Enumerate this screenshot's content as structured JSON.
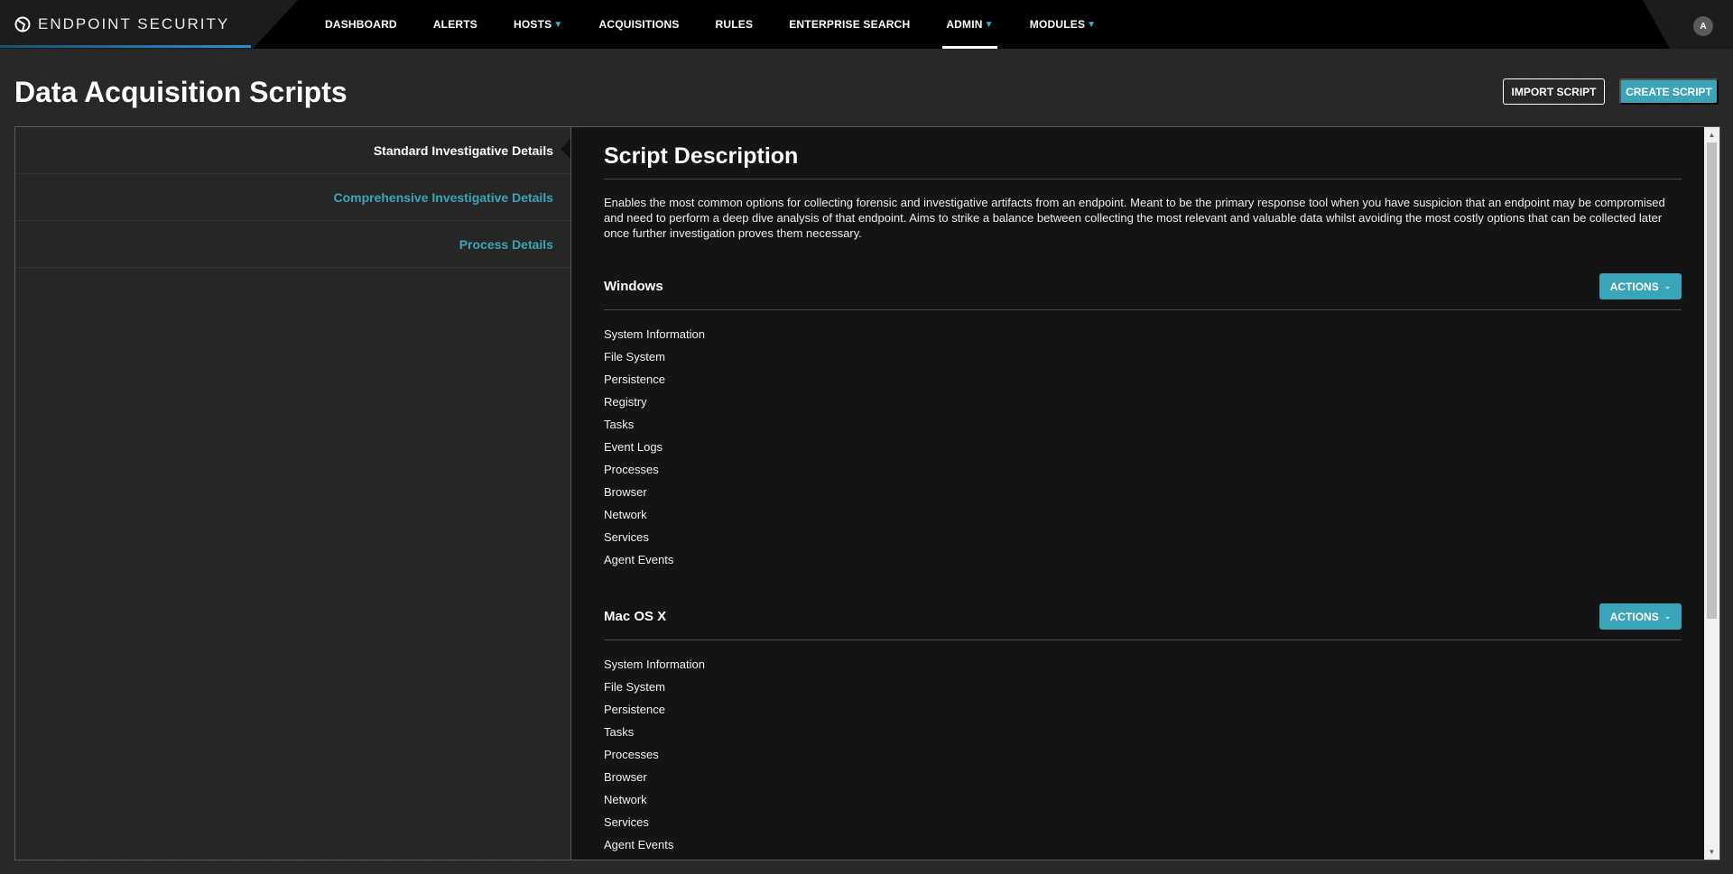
{
  "app": {
    "brand": "ENDPOINT SECURITY",
    "user_initial": "A"
  },
  "nav": {
    "items": [
      {
        "label": "DASHBOARD",
        "dropdown": false
      },
      {
        "label": "ALERTS",
        "dropdown": false
      },
      {
        "label": "HOSTS",
        "dropdown": true
      },
      {
        "label": "ACQUISITIONS",
        "dropdown": false
      },
      {
        "label": "RULES",
        "dropdown": false
      },
      {
        "label": "ENTERPRISE SEARCH",
        "dropdown": false
      },
      {
        "label": "ADMIN",
        "dropdown": true,
        "active": true
      },
      {
        "label": "MODULES",
        "dropdown": true
      }
    ]
  },
  "page": {
    "title": "Data Acquisition Scripts",
    "import_label": "IMPORT SCRIPT",
    "create_label": "CREATE SCRIPT"
  },
  "scripts": {
    "items": [
      {
        "label": "Standard Investigative Details",
        "active": true
      },
      {
        "label": "Comprehensive Investigative Details",
        "active": false
      },
      {
        "label": "Process Details",
        "active": false
      }
    ]
  },
  "detail": {
    "title": "Script Description",
    "description": "Enables the most common options for collecting forensic and investigative artifacts from an endpoint. Meant to be the primary response tool when you have suspicion that an endpoint may be compromised and need to perform a deep dive analysis of that endpoint. Aims to strike a balance between collecting the most relevant and valuable data whilst avoiding the most costly options that can be collected later once further investigation proves them necessary.",
    "sections": [
      {
        "name": "Windows",
        "actions_label": "ACTIONS",
        "items": [
          "System Information",
          "File System",
          "Persistence",
          "Registry",
          "Tasks",
          "Event Logs",
          "Processes",
          "Browser",
          "Network",
          "Services",
          "Agent Events"
        ]
      },
      {
        "name": "Mac OS X",
        "actions_label": "ACTIONS",
        "items": [
          "System Information",
          "File System",
          "Persistence",
          "Tasks",
          "Processes",
          "Browser",
          "Network",
          "Services",
          "Agent Events"
        ]
      }
    ]
  },
  "colors": {
    "accent": "#3aa5b8",
    "nav_bg": "#000000",
    "page_bg": "#262626",
    "detail_bg": "#141414"
  },
  "icons": {
    "brand": "endpoint-logo-icon",
    "dropdown": "chevron-down-icon"
  }
}
